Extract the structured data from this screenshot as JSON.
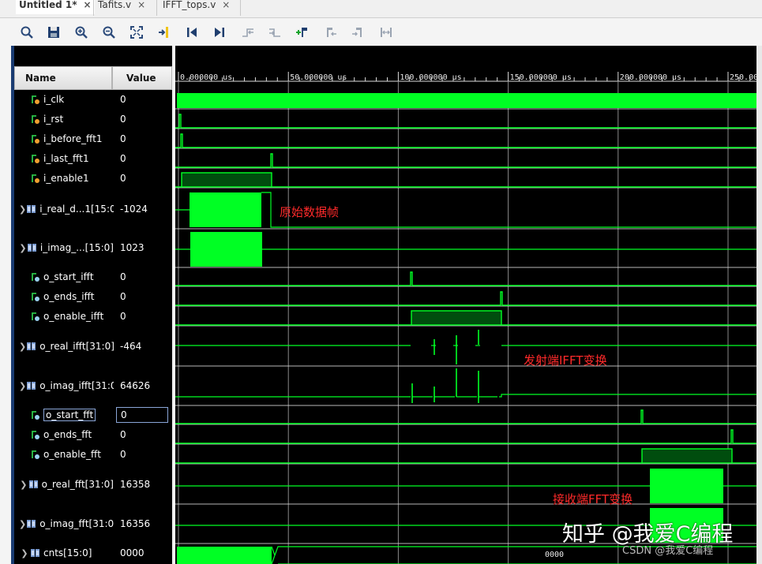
{
  "tabs": [
    {
      "label": "Untitled 1*",
      "close": "×"
    },
    {
      "label": "Tafits.v",
      "close": "×"
    },
    {
      "label": "IFFT_tops.v",
      "close": "×"
    }
  ],
  "toolbar_icons": [
    "search-icon",
    "save-icon",
    "zoom-in-icon",
    "zoom-out-icon",
    "zoom-fit-icon",
    "goto-cursor-icon",
    "goto-start-icon",
    "goto-end-icon",
    "previous-transition-icon",
    "next-transition-icon",
    "add-marker-icon",
    "previous-marker-icon",
    "next-marker-icon",
    "swap-cursors-icon"
  ],
  "columns": {
    "name": "Name",
    "value": "Value"
  },
  "signals": [
    {
      "name": "i_clk",
      "value": "0",
      "icon": "bit-input-icon",
      "expandable": false
    },
    {
      "name": "i_rst",
      "value": "0",
      "icon": "bit-input-icon",
      "expandable": false
    },
    {
      "name": "i_before_fft1",
      "value": "0",
      "icon": "bit-input-icon",
      "expandable": false
    },
    {
      "name": "i_last_fft1",
      "value": "0",
      "icon": "bit-input-icon",
      "expandable": false
    },
    {
      "name": "i_enable1",
      "value": "0",
      "icon": "bit-input-icon",
      "expandable": false
    },
    {
      "name": "i_real_d...1[15:0",
      "value": "-1024",
      "icon": "bus-icon",
      "expandable": true
    },
    {
      "name": "i_imag_...[15:0]",
      "value": "1023",
      "icon": "bus-icon",
      "expandable": true
    },
    {
      "name": "o_start_ifft",
      "value": "0",
      "icon": "bit-output-icon",
      "expandable": false
    },
    {
      "name": "o_ends_ifft",
      "value": "0",
      "icon": "bit-output-icon",
      "expandable": false
    },
    {
      "name": "o_enable_ifft",
      "value": "0",
      "icon": "bit-output-icon",
      "expandable": false
    },
    {
      "name": "o_real_ifft[31:0]",
      "value": "-464",
      "icon": "bus-icon",
      "expandable": true
    },
    {
      "name": "o_imag_ifft[31:0",
      "value": "64626",
      "icon": "bus-icon",
      "expandable": true
    },
    {
      "name": "o_start_fft",
      "value": "0",
      "icon": "bit-output-icon",
      "expandable": false,
      "selected": true
    },
    {
      "name": "o_ends_fft",
      "value": "0",
      "icon": "bit-output-icon",
      "expandable": false
    },
    {
      "name": "o_enable_fft",
      "value": "0",
      "icon": "bit-output-icon",
      "expandable": false
    },
    {
      "name": "o_real_fft[31:0]",
      "value": "16358",
      "icon": "bus-icon",
      "expandable": true
    },
    {
      "name": "o_imag_fft[31:0",
      "value": "16356",
      "icon": "bus-icon",
      "expandable": true
    },
    {
      "name": "cnts[15:0]",
      "value": "0000",
      "icon": "bus-icon",
      "expandable": true
    }
  ],
  "timeline": {
    "ticks": [
      {
        "label": "0.000000 us",
        "time_us": 0
      },
      {
        "label": "50.000000 us",
        "time_us": 50
      },
      {
        "label": "100.000000 us",
        "time_us": 100
      },
      {
        "label": "150.000000 us",
        "time_us": 150
      },
      {
        "label": "200.000000 us",
        "time_us": 200
      },
      {
        "label": "250.000000 us",
        "time_us": 250
      }
    ]
  },
  "cnts_bus_value": "0000",
  "annotations": [
    {
      "text": "原始数据帧"
    },
    {
      "text": "发射端IFFT变换"
    },
    {
      "text": "接收端FFT变换"
    }
  ],
  "watermark": {
    "main": "知乎 @我爱C编程",
    "sub": "CSDN @我爱C编程"
  },
  "colors": {
    "wave": "#00ff24",
    "bus_fill": "#00ff24",
    "enable_fill": "#004d0e",
    "grid": "#d8d8d8",
    "annotation": "#ff2a2a",
    "background": "#000000"
  }
}
